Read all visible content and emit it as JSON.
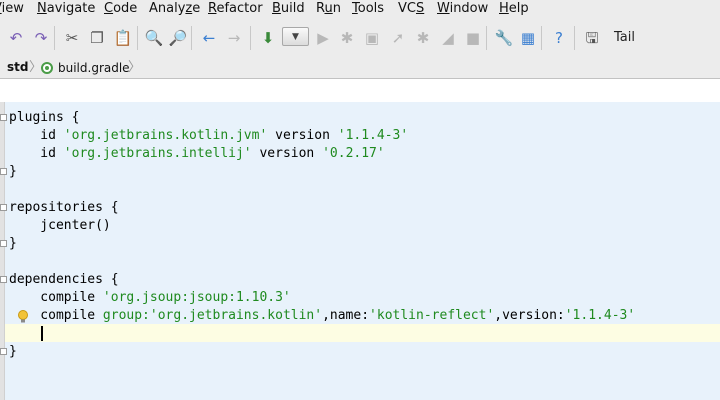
{
  "menu": {
    "items": [
      {
        "label": "View",
        "mnemonic": "V"
      },
      {
        "label": "Navigate",
        "mnemonic": "N"
      },
      {
        "label": "Code",
        "mnemonic": "C"
      },
      {
        "label": "Analyze",
        "mnemonic": "z"
      },
      {
        "label": "Refactor",
        "mnemonic": "R"
      },
      {
        "label": "Build",
        "mnemonic": "B"
      },
      {
        "label": "Run",
        "mnemonic": "u"
      },
      {
        "label": "Tools",
        "mnemonic": "T"
      },
      {
        "label": "VCS",
        "mnemonic": "S"
      },
      {
        "label": "Window",
        "mnemonic": "W"
      },
      {
        "label": "Help",
        "mnemonic": "H"
      }
    ]
  },
  "toolbar": {
    "icons": [
      {
        "name": "undo-icon",
        "glyph": "↶",
        "enabled": true,
        "color": "#7a5fb5"
      },
      {
        "name": "redo-icon",
        "glyph": "↷",
        "enabled": true,
        "color": "#7a5fb5"
      },
      {
        "name": "cut-icon",
        "glyph": "✂",
        "enabled": true
      },
      {
        "name": "copy-icon",
        "glyph": "❐",
        "enabled": true
      },
      {
        "name": "paste-icon",
        "glyph": "📋",
        "enabled": true
      },
      {
        "name": "find-icon",
        "glyph": "🔍",
        "enabled": true
      },
      {
        "name": "replace-icon",
        "glyph": "🔎",
        "enabled": true
      },
      {
        "name": "back-icon",
        "glyph": "←",
        "enabled": true,
        "color": "#3b7fd1"
      },
      {
        "name": "forward-icon",
        "glyph": "→",
        "enabled": false
      },
      {
        "name": "make-project-icon",
        "glyph": "⬇",
        "enabled": true,
        "color": "#3a8a3a"
      },
      {
        "name": "run-icon",
        "glyph": "▶",
        "enabled": false
      },
      {
        "name": "debug-icon",
        "glyph": "✱",
        "enabled": false
      },
      {
        "name": "coverage-icon",
        "glyph": "▣",
        "enabled": false
      },
      {
        "name": "profile-icon",
        "glyph": "➚",
        "enabled": false
      },
      {
        "name": "attach-debugger-icon",
        "glyph": "✱",
        "enabled": false
      },
      {
        "name": "apply-changes-icon",
        "glyph": "◢",
        "enabled": false
      },
      {
        "name": "stop-icon",
        "glyph": "■",
        "enabled": false
      },
      {
        "name": "settings-icon",
        "glyph": "🔧",
        "enabled": true
      },
      {
        "name": "project-structure-icon",
        "glyph": "▦",
        "enabled": true,
        "color": "#3b7fd1"
      },
      {
        "name": "help-icon",
        "glyph": "?",
        "enabled": true,
        "color": "#3b7fd1"
      },
      {
        "name": "tail-icon",
        "glyph": "🖫",
        "enabled": true
      }
    ],
    "tail_label": "Tail"
  },
  "breadcrumb": {
    "root": "std",
    "file": "build.gradle"
  },
  "editor": {
    "lines": [
      [
        {
          "t": "plugins {"
        }
      ],
      [
        {
          "t": "    id "
        },
        {
          "t": "'org.jetbrains.kotlin.jvm'",
          "s": 1
        },
        {
          "t": " version "
        },
        {
          "t": "'1.1.4-3'",
          "s": 1
        }
      ],
      [
        {
          "t": "    id "
        },
        {
          "t": "'org.jetbrains.intellij'",
          "s": 1
        },
        {
          "t": " version "
        },
        {
          "t": "'0.2.17'",
          "s": 1
        }
      ],
      [
        {
          "t": "}"
        }
      ],
      [],
      [
        {
          "t": "repositories {"
        }
      ],
      [
        {
          "t": "    jcenter()"
        }
      ],
      [
        {
          "t": "}"
        }
      ],
      [],
      [
        {
          "t": "dependencies {"
        }
      ],
      [
        {
          "t": "    compile "
        },
        {
          "t": "'org.jsoup:jsoup:1.10.3'",
          "s": 1
        }
      ],
      [
        {
          "t": "    compile "
        },
        {
          "t": "group:",
          "s": 1
        },
        {
          "t": "'org.jetbrains.kotlin'",
          "s": 1
        },
        {
          "t": ",name:"
        },
        {
          "t": "'kotlin-reflect'",
          "s": 1
        },
        {
          "t": ",version:"
        },
        {
          "t": "'1.1.4-3'",
          "s": 1
        }
      ],
      [],
      [
        {
          "t": "}"
        }
      ]
    ],
    "caret_line": 13,
    "intention_bulb_icon": "lightbulb-icon"
  }
}
